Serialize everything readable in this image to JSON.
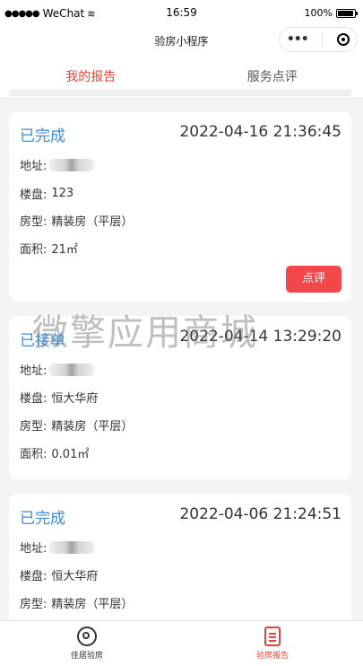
{
  "status_bar": {
    "signal": "●●●●●",
    "carrier": "WeChat",
    "time": "16:59",
    "battery": "100%"
  },
  "nav": {
    "title": "验房小程序",
    "more_icon": "•••"
  },
  "tabs": [
    {
      "label": "我的报告",
      "active": true
    },
    {
      "label": "服务点评",
      "active": false
    }
  ],
  "watermark": "微擎应用商城",
  "reports": [
    {
      "status": "已完成",
      "datetime": "2022-04-16 21:36:45",
      "address_label": "地址:",
      "estate_label": "楼盘:",
      "estate": "123",
      "house_type_label": "房型:",
      "house_type": "精装房（平层）",
      "area_label": "面积:",
      "area": "21㎡",
      "action": "点评"
    },
    {
      "status": "已接单",
      "datetime": "2022-04-14 13:29:20",
      "address_label": "地址:",
      "estate_label": "楼盘:",
      "estate": "恒大华府",
      "house_type_label": "房型:",
      "house_type": "精装房（平层）",
      "area_label": "面积:",
      "area": "0.01㎡"
    },
    {
      "status": "已完成",
      "datetime": "2022-04-06 21:24:51",
      "address_label": "地址:",
      "estate_label": "楼盘:",
      "estate": "恒大华府",
      "house_type_label": "房型:",
      "house_type": "精装房（平层）"
    }
  ],
  "bottom_nav": [
    {
      "label": "佳居验房",
      "icon": "target-icon",
      "active": false
    },
    {
      "label": "验房报告",
      "icon": "report-icon",
      "active": true
    }
  ],
  "colors": {
    "accent": "#e6433a",
    "status_blue": "#3a8de0",
    "button_red": "#f2484a"
  }
}
